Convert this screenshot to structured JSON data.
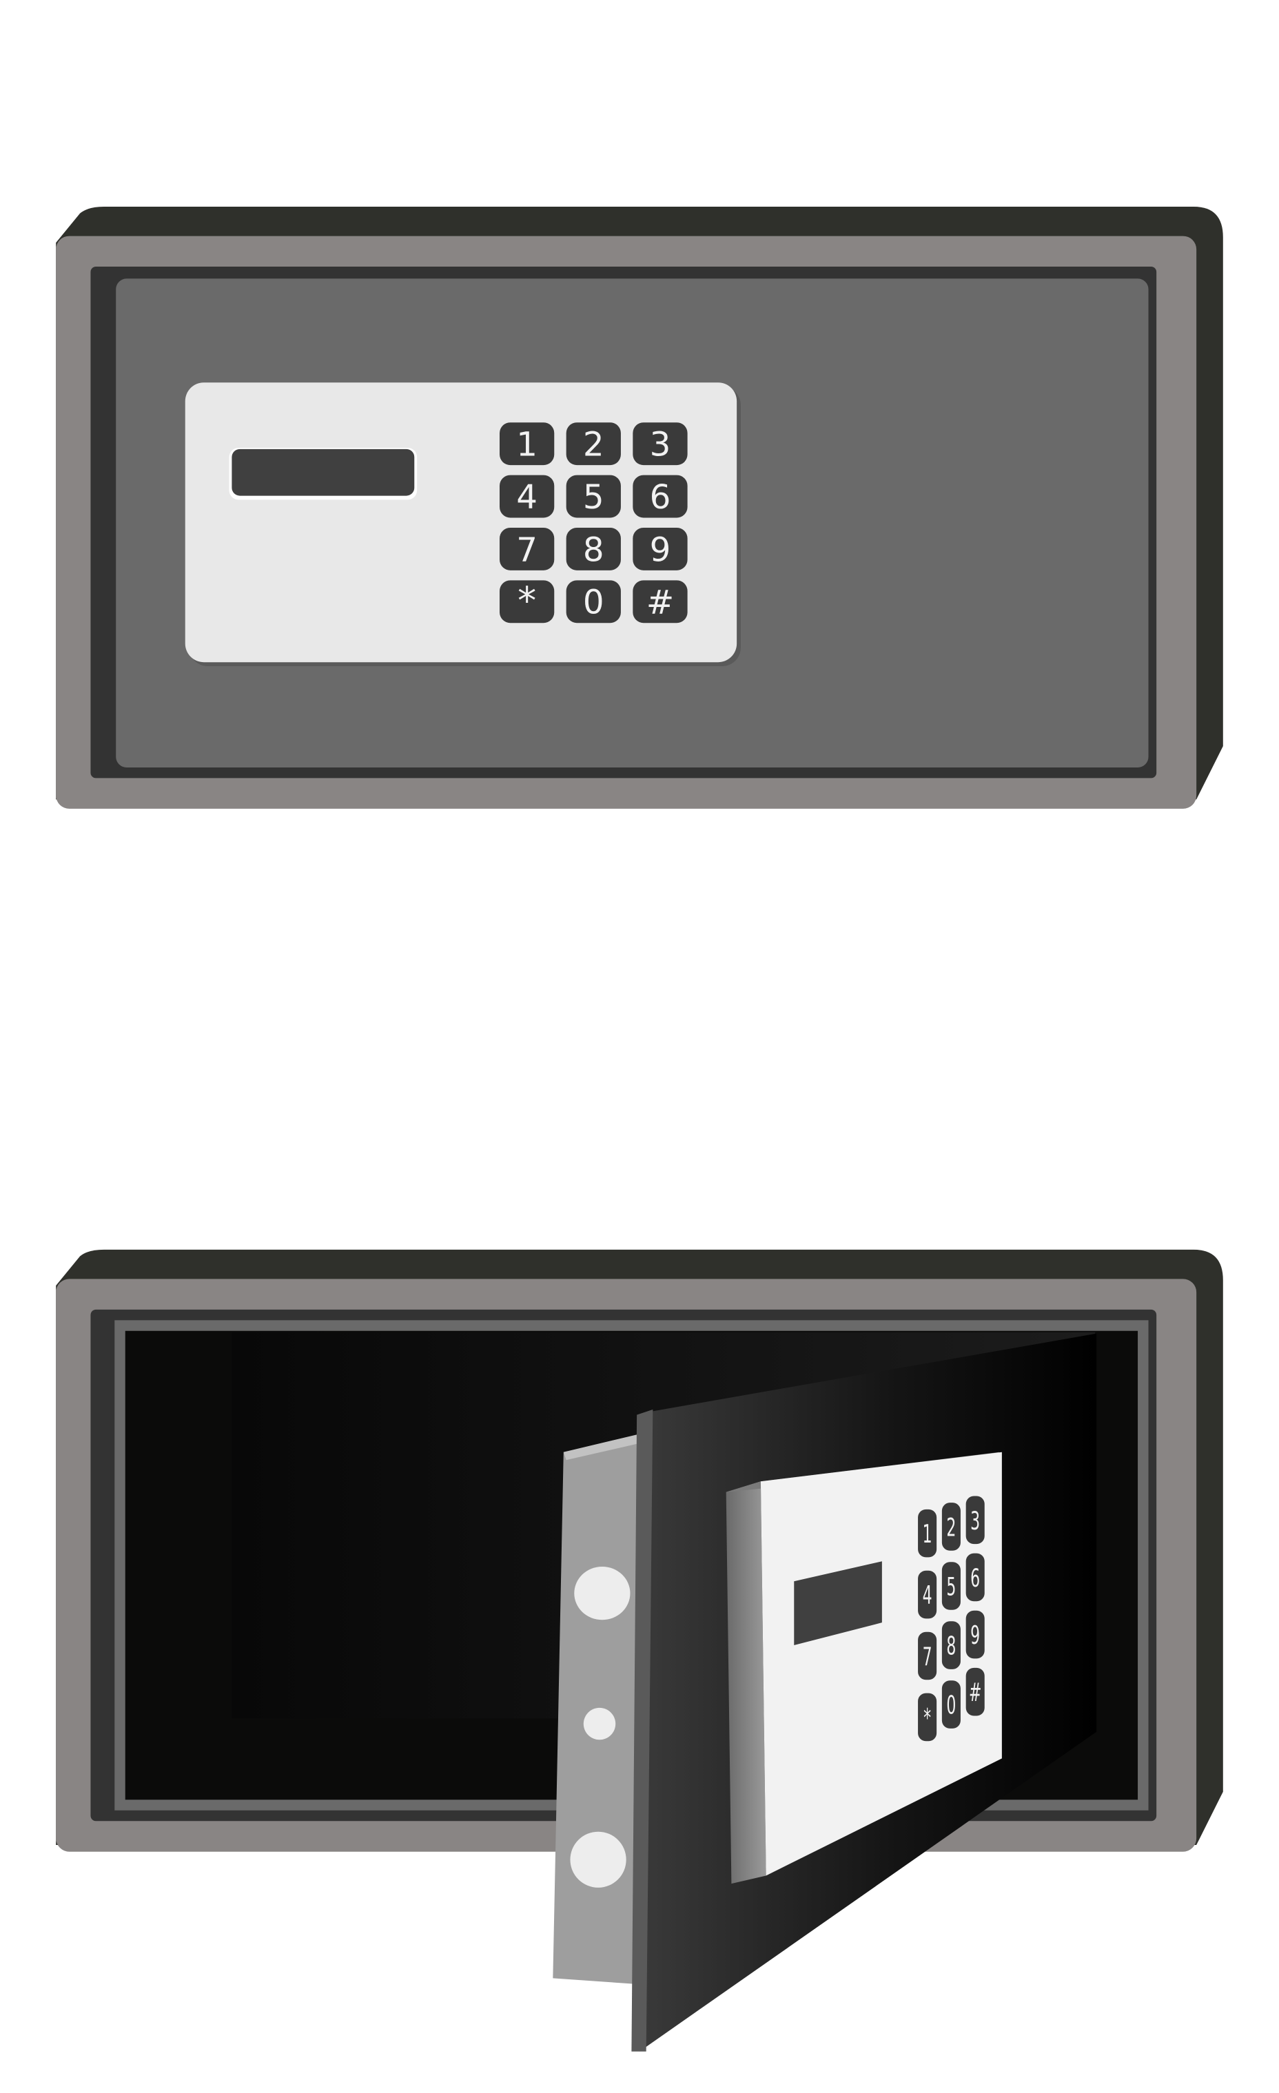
{
  "colors": {
    "background": "#ffffff",
    "frame_dark": "#2f302b",
    "frame_light": "#898584",
    "frame_inner": "#333333",
    "door_face": "#6a6a6a",
    "panel": "#e8e8e8",
    "display": "#404040",
    "key": "#3a3a3a",
    "key_text": "#f2f2f2",
    "interior": "#0b0b0b",
    "hinge": "#9e9e9e",
    "open_door": "#1a1a1a"
  },
  "closed_safe": {
    "keys": [
      "1",
      "2",
      "3",
      "4",
      "5",
      "6",
      "7",
      "8",
      "9",
      "*",
      "0",
      "#"
    ]
  },
  "open_safe": {
    "keys": [
      "1",
      "2",
      "3",
      "4",
      "5",
      "6",
      "7",
      "8",
      "9",
      "*",
      "0",
      "#"
    ]
  }
}
